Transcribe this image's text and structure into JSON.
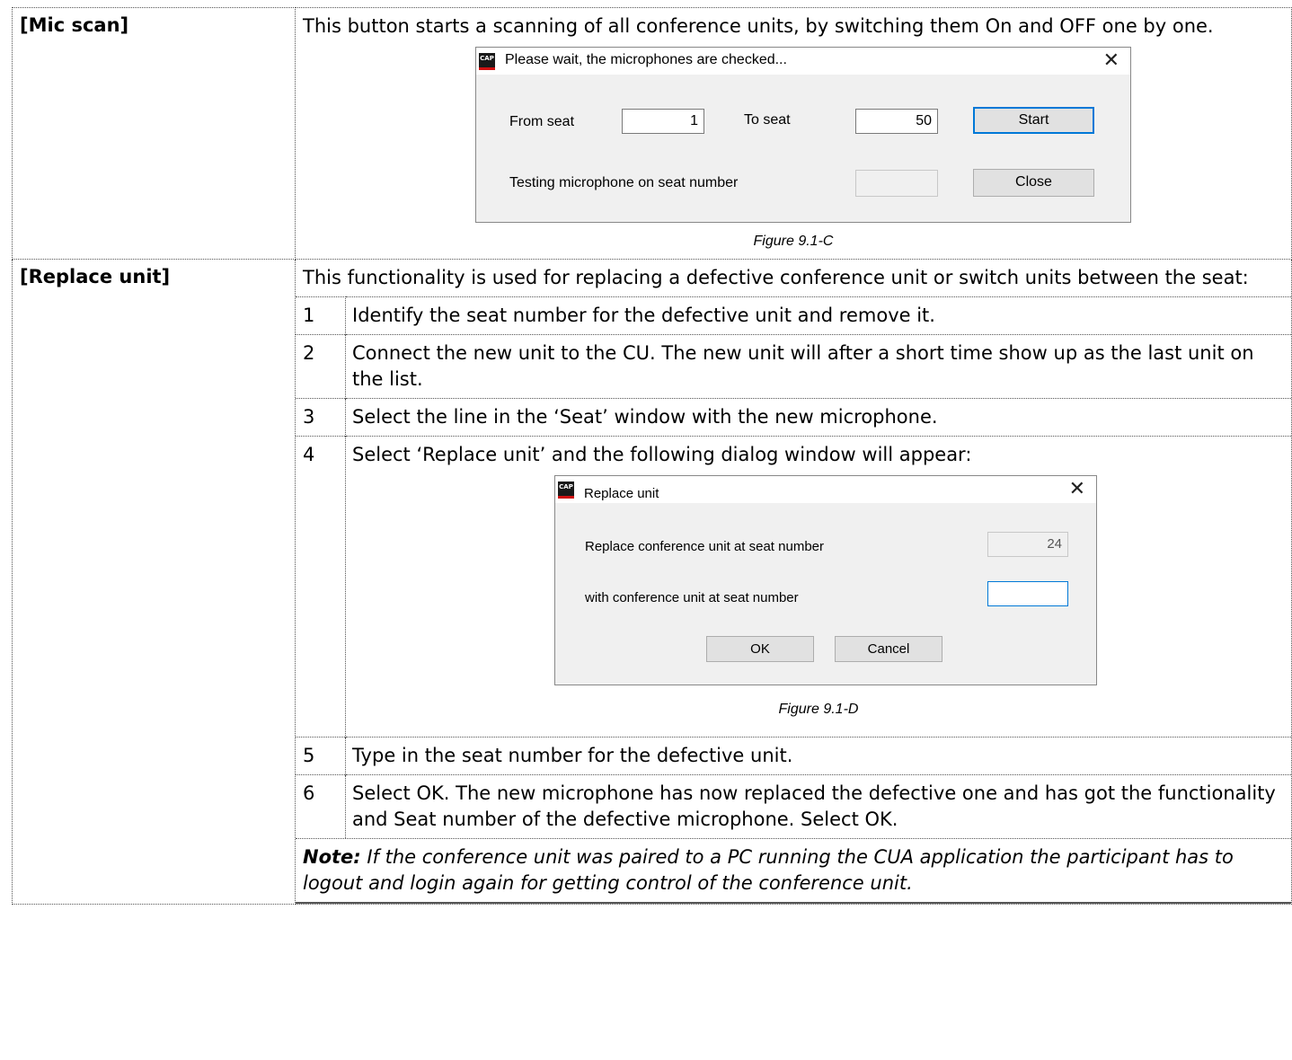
{
  "mic_scan": {
    "label": "[Mic scan]",
    "description": "This button starts a scanning of all conference units, by switching them On and OFF one by one.",
    "dialog": {
      "app_icon": "CAP",
      "title": "Please wait, the microphones are checked...",
      "close_glyph": "✕",
      "from_label": "From seat",
      "from_value": "1",
      "to_label": "To seat",
      "to_value": "50",
      "start_button": "Start",
      "testing_label": "Testing microphone on seat number",
      "testing_value": "",
      "close_button": "Close"
    },
    "caption": "Figure 9.1-C"
  },
  "replace_unit": {
    "label": "[Replace unit]",
    "description": "This functionality is used for replacing a defective conference unit or switch units between the seat:",
    "steps": [
      {
        "num": "1",
        "text": "Identify the seat number for the defective unit and remove it."
      },
      {
        "num": "2",
        "text": "Connect the new unit to the CU. The new unit will after a short time show up as the last unit on the list."
      },
      {
        "num": "3",
        "text": "Select the line in the ‘Seat’ window with the new microphone."
      },
      {
        "num": "4",
        "text": "Select ‘Replace unit’ and the following dialog window will appear:"
      },
      {
        "num": "5",
        "text": "Type in the seat number for the defective unit."
      },
      {
        "num": "6",
        "text": "Select OK. The new microphone has now replaced the defective one and has got the functionality and Seat number of the defective microphone. Select OK."
      }
    ],
    "dialog": {
      "app_icon": "CAP",
      "title": "Replace unit",
      "close_glyph": "✕",
      "replace_label": "Replace conference unit at seat number",
      "replace_value": "24",
      "with_label": "with conference unit at seat number",
      "with_value": "",
      "ok_button": "OK",
      "cancel_button": "Cancel"
    },
    "caption": "Figure 9.1-D",
    "note_label": "Note:",
    "note_text": " If the conference unit was paired to a PC running the CUA application the participant has to logout and login again for getting control of the conference unit."
  }
}
